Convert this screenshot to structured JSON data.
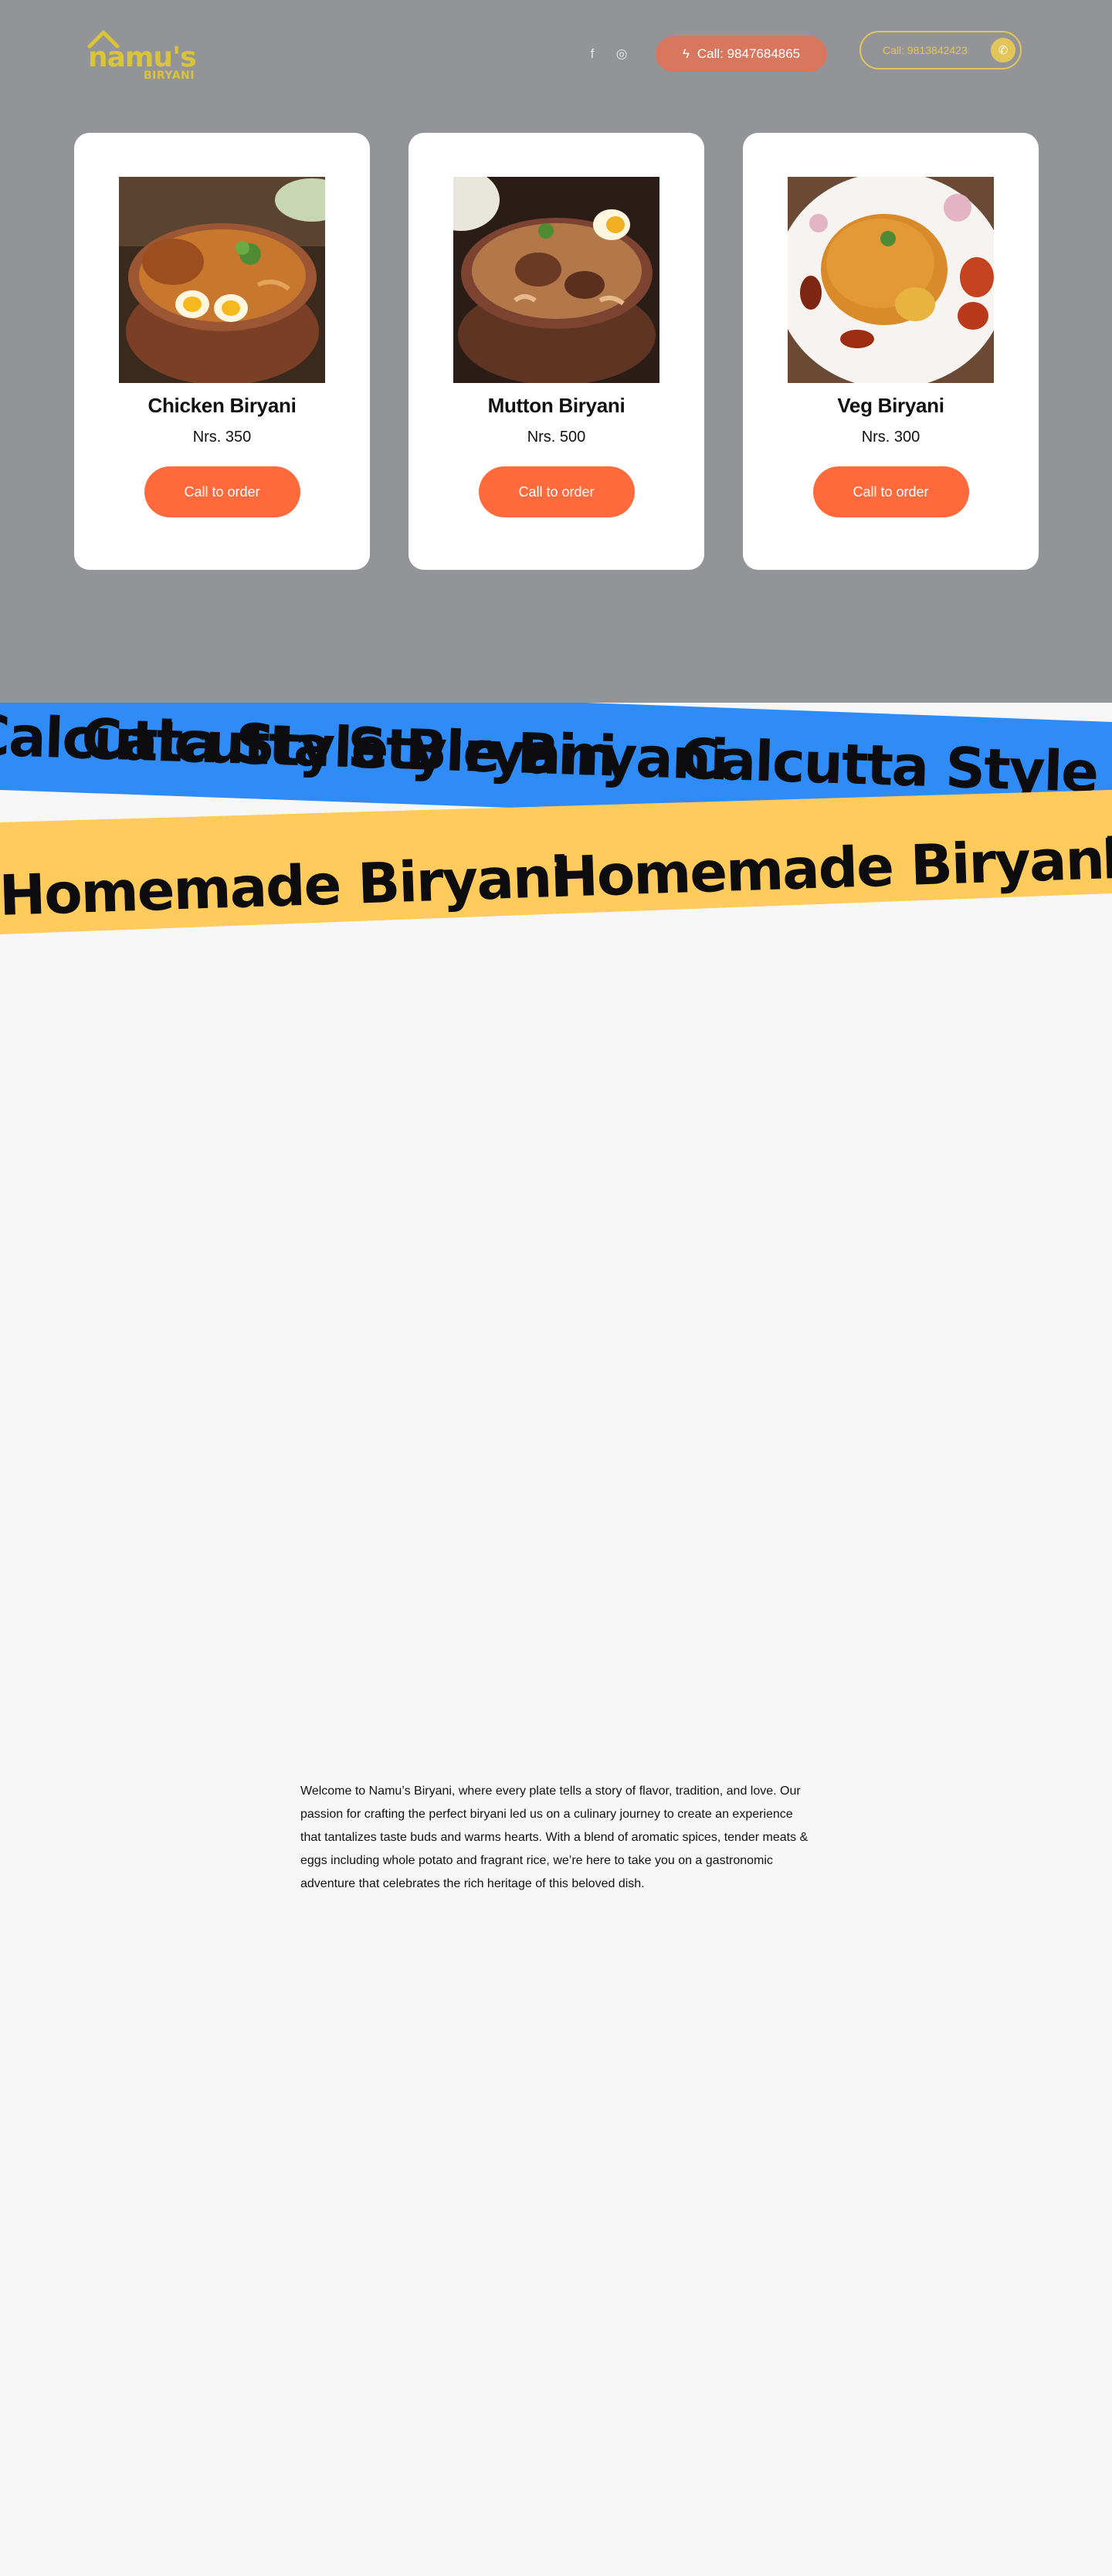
{
  "header": {
    "logo_text": "namu's",
    "logo_subtext": "BIRYANI",
    "social": [
      {
        "icon": "facebook-icon",
        "glyph": "f"
      },
      {
        "icon": "instagram-icon",
        "glyph": "◎"
      }
    ],
    "call_primary": "Call: 9847684865",
    "call_secondary": "Call: 9813842423"
  },
  "menu": [
    {
      "name": "Chicken Biryani",
      "price": "Nrs. 350",
      "button": "Call to order"
    },
    {
      "name": "Mutton Biryani",
      "price": "Nrs. 500",
      "button": "Call to order"
    },
    {
      "name": "Veg Biryani",
      "price": "Nrs. 300",
      "button": "Call to order"
    }
  ],
  "bands": {
    "blue_text": "Calcutta Style Biryani",
    "yellow_text": "Homemade Biryani"
  },
  "about": {
    "text": "Welcome to Namu’s Biryani, where every plate tells a story of flavor, tradition, and love. Our passion for crafting the perfect biryani led us on a culinary journey to create an experience that tantalizes taste buds and warms hearts. With a blend of aromatic spices, tender meats & eggs including whole potato and fragrant rice, we’re here to take you on a gastronomic adventure that celebrates the rich heritage of this beloved dish."
  },
  "colors": {
    "hero_bg": "#939498",
    "accent_orange": "#ff6a3d",
    "call_pill": "#d9765e",
    "gold": "#e3c65a",
    "band_blue": "#2f8cf7",
    "band_yellow": "#ffcb5c",
    "page_bg": "#f7f7f7"
  }
}
